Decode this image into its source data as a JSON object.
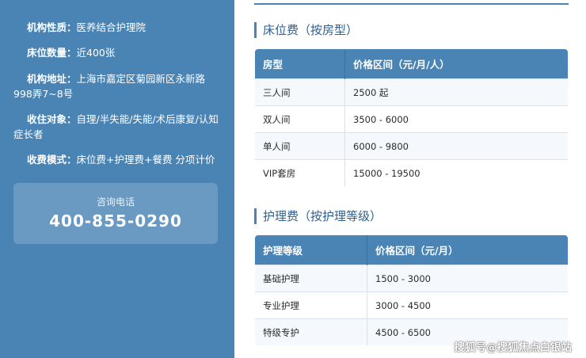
{
  "sidebar": {
    "info": [
      {
        "label": "机构性质：",
        "value": "医养结合护理院"
      },
      {
        "label": "床位数量：",
        "value": "近400张"
      },
      {
        "label": "机构地址：",
        "value": "上海市嘉定区菊园新区永新路998弄7~8号"
      },
      {
        "label": "收住对象：",
        "value": "自理/半失能/失能/术后康复/认知症长者"
      },
      {
        "label": "收费模式：",
        "value": "床位费+护理费+餐费 分项计价"
      }
    ],
    "consult": {
      "label": "咨询电话",
      "phone": "400-855-0290"
    }
  },
  "bed_fees": {
    "title": "床位费（按房型）",
    "headers": [
      "房型",
      "价格区间（元/月/人）"
    ],
    "rows": [
      [
        "三人间",
        "2500 起"
      ],
      [
        "双人间",
        "3500 - 6000"
      ],
      [
        "单人间",
        "6000 - 9800"
      ],
      [
        "VIP套房",
        "15000 - 19500"
      ]
    ]
  },
  "care_fees": {
    "title": "护理费（按护理等级）",
    "headers": [
      "护理等级",
      "价格区间（元/月）"
    ],
    "rows": [
      [
        "基础护理",
        "1500 - 3000"
      ],
      [
        "专业护理",
        "3000 - 4500"
      ],
      [
        "特级专护",
        "4500 - 6500"
      ]
    ]
  },
  "watermark": "搜狐号@搜狐焦点白银站"
}
